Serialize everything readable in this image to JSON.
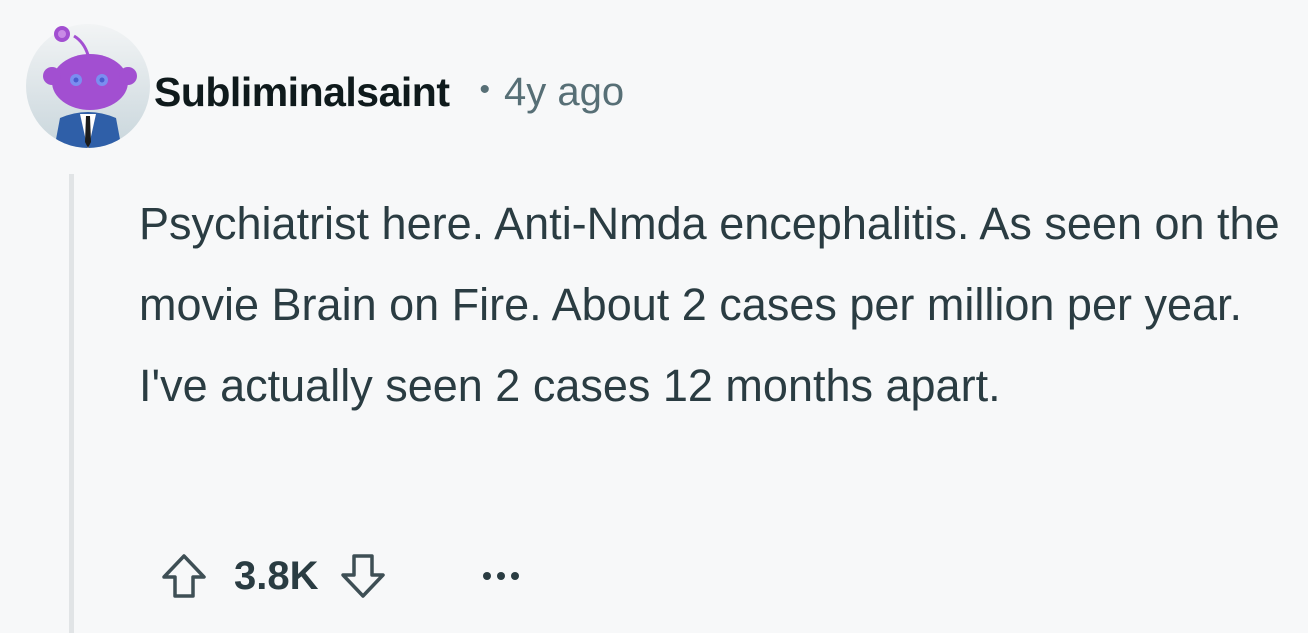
{
  "comment": {
    "author": "Subliminalsaint",
    "separator": "•",
    "timestamp": "4y ago",
    "body": "Psychiatrist here. Anti-Nmda encephalitis. As seen on the movie Brain on Fire. About 2 cases per million per year. I've actually seen 2 cases 12 months apart.",
    "score": "3.8K"
  },
  "icons": {
    "avatar": "snoo-avatar",
    "upvote": "upvote-arrow-icon",
    "downvote": "downvote-arrow-icon",
    "more": "more-options-icon"
  },
  "colors": {
    "background": "#f7f8f9",
    "username": "#0f1a1c",
    "meta": "#576f76",
    "body_text": "#2a3c42",
    "thread_line": "#e1e4e6",
    "avatar_purple": "#a24fd1"
  }
}
